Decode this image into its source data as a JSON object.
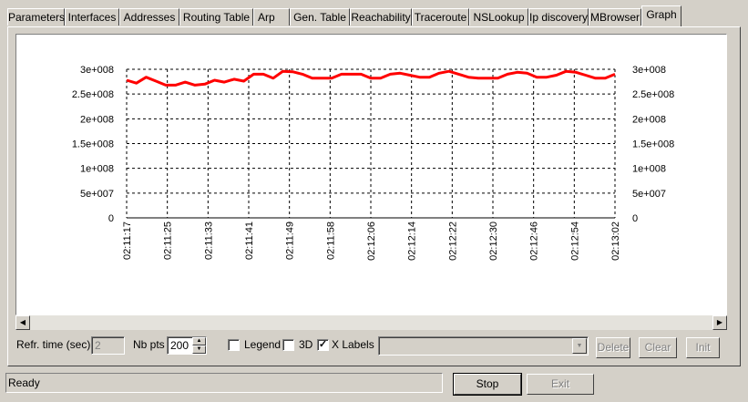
{
  "tabs": [
    {
      "label": "Parameters",
      "active": false
    },
    {
      "label": "Interfaces",
      "active": false
    },
    {
      "label": "Addresses",
      "active": false
    },
    {
      "label": "Routing Table",
      "active": false
    },
    {
      "label": "Arp",
      "active": false
    },
    {
      "label": "Gen. Table",
      "active": false
    },
    {
      "label": "Reachability",
      "active": false
    },
    {
      "label": "Traceroute",
      "active": false
    },
    {
      "label": "NSLookup",
      "active": false
    },
    {
      "label": "Ip discovery",
      "active": false
    },
    {
      "label": "MBrowser",
      "active": false
    },
    {
      "label": "Graph",
      "active": true
    }
  ],
  "chart_data": {
    "type": "line",
    "y_ticks": [
      "3e+008",
      "2.5e+008",
      "2e+008",
      "1.5e+008",
      "1e+008",
      "5e+007",
      "0"
    ],
    "y_tick_values": [
      300000000,
      250000000,
      200000000,
      150000000,
      100000000,
      50000000,
      0
    ],
    "ylim": [
      0,
      300000000
    ],
    "x_ticks": [
      "02:11:17",
      "02:11:25",
      "02:11:33",
      "02:11:41",
      "02:11:49",
      "02:11:58",
      "02:12:06",
      "02:12:14",
      "02:12:22",
      "02:12:30",
      "02:12:46",
      "02:12:54",
      "02:13:02"
    ],
    "grid": true,
    "line_color": "#ff0000",
    "series": [
      {
        "values": [
          278000000,
          272000000,
          284000000,
          276000000,
          268000000,
          268000000,
          274000000,
          268000000,
          270000000,
          278000000,
          274000000,
          280000000,
          276000000,
          290000000,
          290000000,
          282000000,
          296000000,
          295000000,
          290000000,
          282000000,
          282000000,
          282000000,
          290000000,
          290000000,
          290000000,
          282000000,
          282000000,
          290000000,
          292000000,
          288000000,
          284000000,
          284000000,
          292000000,
          296000000,
          290000000,
          284000000,
          282000000,
          282000000,
          282000000,
          290000000,
          294000000,
          292000000,
          284000000,
          284000000,
          288000000,
          296000000,
          294000000,
          288000000,
          282000000,
          282000000,
          290000000
        ]
      }
    ]
  },
  "controls": {
    "refr_label": "Refr. time (sec)",
    "refr_value": "2",
    "nbpts_label": "Nb pts",
    "nbpts_value": "200",
    "legend_label": "Legend",
    "legend_checked": false,
    "threed_label": "3D",
    "threed_checked": false,
    "xlabels_label": "X Labels",
    "xlabels_checked": true,
    "combo_value": "",
    "delete_label": "Delete",
    "clear_label": "Clear",
    "init_label": "Init"
  },
  "status": {
    "text": "Ready",
    "stop_label": "Stop",
    "exit_label": "Exit"
  }
}
